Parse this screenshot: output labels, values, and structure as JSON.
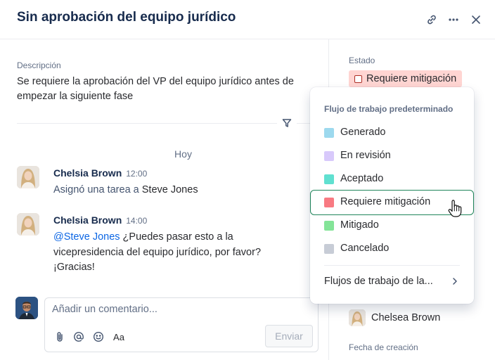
{
  "header": {
    "title": "Sin aprobación del equipo jurídico",
    "icons": [
      "link-icon",
      "more-icon",
      "close-icon"
    ]
  },
  "description": {
    "label": "Descripción",
    "text": "Se requiere la aprobación del VP del equipo jurídico antes de empezar la siguiente fase"
  },
  "activity": {
    "day_label": "Hoy",
    "messages": [
      {
        "author": "Chelsia Brown",
        "time": "12:00",
        "text_prefix": "Asignó una tarea a ",
        "text_strong": "Steve Jones"
      },
      {
        "author": "Chelsia Brown",
        "time": "14:00",
        "mention": "@Steve Jones",
        "text": " ¿Puedes pasar esto a la vicepresidencia del equipo jurídico, por favor? ¡Gracias!"
      }
    ]
  },
  "composer": {
    "placeholder": "Añadir un comentario...",
    "format_label": "Aa",
    "send_label": "Enviar",
    "tools": [
      "attachment-icon",
      "mention-icon",
      "emoji-icon",
      "text-format-icon"
    ]
  },
  "sidebar": {
    "status_label": "Estado",
    "status_value": "Requiere mitigación",
    "assignee_name": "Chelsea Brown",
    "created_label": "Fecha de creación"
  },
  "dropdown": {
    "heading": "Flujo de trabajo predeterminado",
    "items": [
      {
        "label": "Generado",
        "color": "#9dd9ee"
      },
      {
        "label": "En revisión",
        "color": "#d8c9fb"
      },
      {
        "label": "Aceptado",
        "color": "#60e0d0"
      },
      {
        "label": "Requiere mitigación",
        "color": "#f87a82"
      },
      {
        "label": "Mitigado",
        "color": "#84e498"
      },
      {
        "label": "Cancelado",
        "color": "#c7ccd6"
      }
    ],
    "hovered_index": 3,
    "more_label": "Flujos de trabajo de la..."
  },
  "colors": {
    "accent": "#0c66e4",
    "hover_border": "#1f845a",
    "status_chip_bg": "#ffd5d2"
  }
}
